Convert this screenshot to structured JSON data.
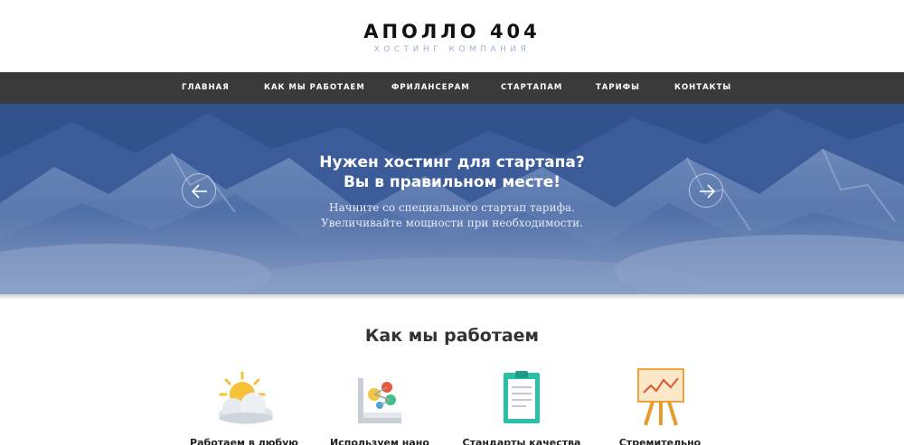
{
  "brand": {
    "title": "АПОЛЛО 404",
    "subtitle": "ХОСТИНГ КОМПАНИЯ"
  },
  "nav": {
    "items": [
      {
        "label": "ГЛАВНАЯ"
      },
      {
        "label": "КАК МЫ РАБОТАЕМ"
      },
      {
        "label": "ФРИЛАНСЕРАМ"
      },
      {
        "label": "СТАРТАПАМ"
      },
      {
        "label": "ТАРИФЫ"
      },
      {
        "label": "КОНТАКТЫ"
      }
    ]
  },
  "hero": {
    "headline_line1": "Нужен хостинг для стартапа?",
    "headline_line2": "Вы в правильном месте!",
    "text_line1": "Начните со специального стартап тарифа.",
    "text_line2": "Увеличивайте мощности при необходимости.",
    "prev_icon": "arrow-left-icon",
    "next_icon": "arrow-right-icon",
    "overlay_color": "#2f4f8c"
  },
  "how": {
    "title": "Как мы работаем",
    "features": [
      {
        "title": "Работаем в любую",
        "icon": "sun-cloud-icon"
      },
      {
        "title": "Используем нано",
        "icon": "molecule-chart-icon"
      },
      {
        "title": "Стандарты качества",
        "icon": "clipboard-icon"
      },
      {
        "title": "Стремительно",
        "icon": "easel-chart-icon"
      }
    ]
  }
}
